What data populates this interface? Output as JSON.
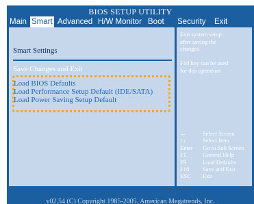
{
  "title": "BIOS SETUP UTILITY",
  "menu": {
    "items": [
      {
        "label": "Main",
        "active": false
      },
      {
        "label": "Smart",
        "active": true
      },
      {
        "label": "Advanced",
        "active": false
      },
      {
        "label": "H/W Monitor",
        "active": false
      },
      {
        "label": "Boot",
        "active": false
      },
      {
        "label": "Security",
        "active": false
      },
      {
        "label": "Exit",
        "active": false
      }
    ]
  },
  "left": {
    "section_title": "Smart Settings",
    "save_changes": "Save Changes and Exit",
    "options": [
      "Load BIOS Defaults",
      "Load Performance Setup Default (IDE/SATA)",
      "Load Power Saving Setup Default"
    ]
  },
  "right": {
    "help_lines": [
      "Exit system setup",
      "after saving the",
      "changes.",
      "",
      "F10 key can be used",
      "for this operation."
    ],
    "keys": [
      {
        "key": "↔",
        "desc": "Select Screen"
      },
      {
        "key": "↑↓",
        "desc": "Select Item"
      },
      {
        "key": "Enter",
        "desc": "Go to Sub Screen"
      },
      {
        "key": "F1",
        "desc": "General Help"
      },
      {
        "key": "F9",
        "desc": "Load Defaults"
      },
      {
        "key": "F10",
        "desc": "Save and Exit"
      },
      {
        "key": "ESC",
        "desc": "Exit"
      }
    ]
  },
  "footer": "v02.54 (C) Copyright 1985-2005, American Megatrends, Inc.",
  "colors": {
    "background_blue": "#1b5fa0",
    "panel": "#c6d7eb",
    "highlight_border": "#f3a524",
    "option_text": "#1e64b7"
  }
}
